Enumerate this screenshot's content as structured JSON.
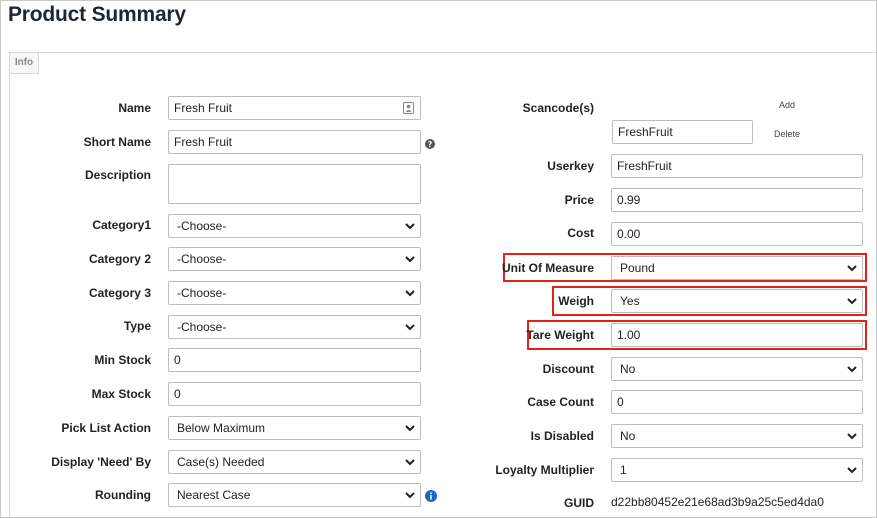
{
  "page": {
    "title": "Product Summary",
    "tab": "Info"
  },
  "left": {
    "name": {
      "label": "Name",
      "value": "Fresh Fruit"
    },
    "short_name": {
      "label": "Short Name",
      "value": "Fresh Fruit"
    },
    "description": {
      "label": "Description",
      "value": ""
    },
    "category1": {
      "label": "Category1",
      "value": "-Choose-"
    },
    "category2": {
      "label": "Category 2",
      "value": "-Choose-"
    },
    "category3": {
      "label": "Category 3",
      "value": "-Choose-"
    },
    "type": {
      "label": "Type",
      "value": "-Choose-"
    },
    "min_stock": {
      "label": "Min Stock",
      "value": "0"
    },
    "max_stock": {
      "label": "Max Stock",
      "value": "0"
    },
    "pick_list_action": {
      "label": "Pick List Action",
      "value": "Below Maximum"
    },
    "display_need_by": {
      "label": "Display 'Need' By",
      "value": "Case(s) Needed"
    },
    "rounding": {
      "label": "Rounding",
      "value": "Nearest Case"
    }
  },
  "right": {
    "scancodes": {
      "label": "Scancode(s)",
      "value": "FreshFruit",
      "add_label": "Add",
      "delete_label": "Delete"
    },
    "userkey": {
      "label": "Userkey",
      "value": "FreshFruit"
    },
    "price": {
      "label": "Price",
      "value": "0.99"
    },
    "cost": {
      "label": "Cost",
      "value": "0.00"
    },
    "unit_of_measure": {
      "label": "Unit Of Measure",
      "value": "Pound"
    },
    "weigh": {
      "label": "Weigh",
      "value": "Yes"
    },
    "tare_weight": {
      "label": "Tare Weight",
      "value": "1.00"
    },
    "discount": {
      "label": "Discount",
      "value": "No"
    },
    "case_count": {
      "label": "Case Count",
      "value": "0"
    },
    "is_disabled": {
      "label": "Is Disabled",
      "value": "No"
    },
    "loyalty_multiplier": {
      "label": "Loyalty Multiplier",
      "value": "1"
    },
    "guid": {
      "label": "GUID",
      "value": "d22bb80452e21e68ad3b9a25c5ed4da0"
    }
  },
  "colors": {
    "highlight": "#e2231a",
    "help_icon": "#555555",
    "info_icon": "#1a66cc"
  },
  "icons": {
    "contact_card": "contact-card-icon",
    "help": "help-icon",
    "info": "info-icon",
    "dropdown": "chevron-down-icon"
  }
}
